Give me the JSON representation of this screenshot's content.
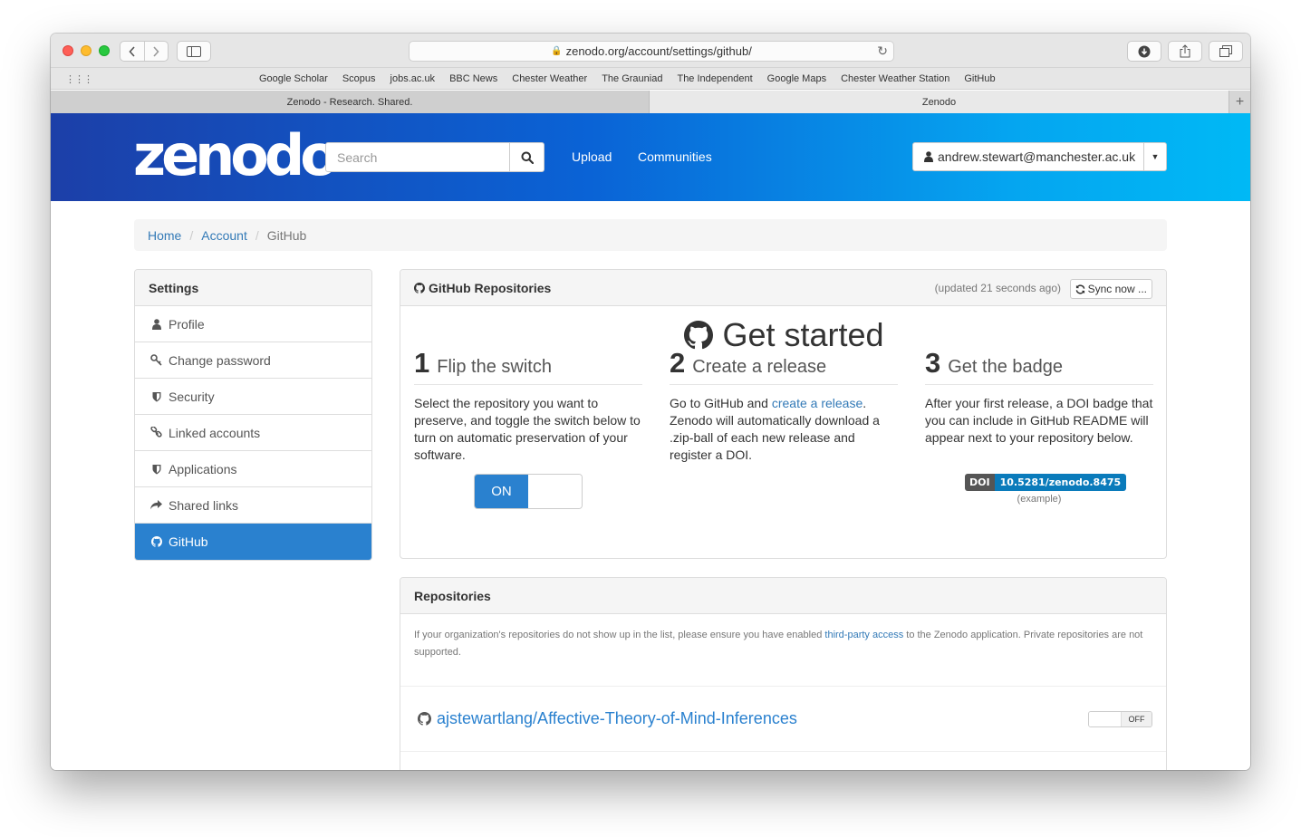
{
  "browser": {
    "url": "zenodo.org/account/settings/github/",
    "bookmarks": [
      "Google Scholar",
      "Scopus",
      "jobs.ac.uk",
      "BBC News",
      "Chester Weather",
      "The Grauniad",
      "The Independent",
      "Google Maps",
      "Chester Weather Station",
      "GitHub"
    ],
    "tabs": [
      {
        "title": "Zenodo - Research. Shared."
      },
      {
        "title": "Zenodo"
      }
    ],
    "new_tab_glyph": "+"
  },
  "header": {
    "logo": "zenodo",
    "search_placeholder": "Search",
    "links": [
      "Upload",
      "Communities"
    ],
    "user_email": "andrew.stewart@manchester.ac.uk",
    "brand_colors": [
      "#1c3fa8",
      "#00b9f5"
    ]
  },
  "breadcrumb": {
    "items": [
      "Home",
      "Account"
    ],
    "active": "GitHub"
  },
  "sidebar": {
    "title": "Settings",
    "items": [
      {
        "label": "Profile",
        "icon": "user-icon"
      },
      {
        "label": "Change password",
        "icon": "key-icon"
      },
      {
        "label": "Security",
        "icon": "shield-icon"
      },
      {
        "label": "Linked accounts",
        "icon": "link-icon"
      },
      {
        "label": "Applications",
        "icon": "shield-icon"
      },
      {
        "label": "Shared links",
        "icon": "share-icon"
      },
      {
        "label": "GitHub",
        "icon": "github-icon",
        "active": true
      }
    ],
    "active_color": "#2a81cf"
  },
  "github_panel": {
    "title": "GitHub Repositories",
    "updated": "(updated 21 seconds ago)",
    "sync_label": "Sync now ...",
    "get_started": "Get started",
    "steps": [
      {
        "number": "1",
        "title": "Flip the switch",
        "body": "Select the repository you want to preserve, and toggle the switch below to turn on automatic preservation of your software."
      },
      {
        "number": "2",
        "title": "Create a release",
        "body_prefix": "Go to GitHub and ",
        "body_link": "create a release",
        "body_suffix": ". Zenodo will automatically download a .zip-ball of each new release and register a DOI."
      },
      {
        "number": "3",
        "title": "Get the badge",
        "body": "After your first release, a DOI badge that you can include in GitHub README will appear next to your repository below."
      }
    ],
    "toggle_on_label": "ON",
    "badge": {
      "left": "DOI",
      "right": "10.5281/zenodo.8475"
    },
    "badge_caption": "(example)"
  },
  "repositories_panel": {
    "title": "Repositories",
    "notice_prefix": "If your organization's repositories do not show up in the list, please ensure you have enabled ",
    "notice_link": "third-party access",
    "notice_suffix": " to the Zenodo application. Private repositories are not supported.",
    "repos": [
      {
        "name": "ajstewartlang/Affective-Theory-of-Mind-Inferences",
        "toggle": "OFF"
      }
    ]
  }
}
